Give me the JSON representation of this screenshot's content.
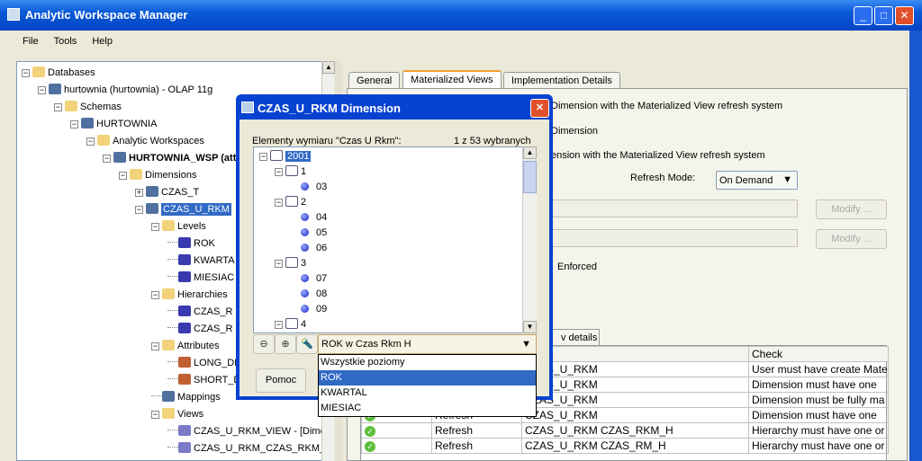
{
  "window": {
    "title": "Analytic Workspace Manager",
    "controls": [
      "_",
      "□",
      "✕"
    ]
  },
  "menu": [
    "File",
    "Tools",
    "Help"
  ],
  "tree": [
    {
      "label": "Databases",
      "level": 0,
      "exp": "-",
      "icon": "folder-db"
    },
    {
      "label": "hurtownia (hurtownia) - OLAP 11g",
      "level": 1,
      "exp": "-",
      "icon": "database"
    },
    {
      "label": "Schemas",
      "level": 2,
      "exp": "-",
      "icon": "folder-schema"
    },
    {
      "label": "HURTOWNIA",
      "level": 3,
      "exp": "-",
      "icon": "schema"
    },
    {
      "label": "Analytic Workspaces",
      "level": 4,
      "exp": "-",
      "icon": "folder-aw"
    },
    {
      "label": "HURTOWNIA_WSP (atta",
      "level": 5,
      "exp": "-",
      "icon": "aw",
      "bold": true
    },
    {
      "label": "Dimensions",
      "level": 6,
      "exp": "-",
      "icon": "folder-dimension"
    },
    {
      "label": "CZAS_T",
      "level": 7,
      "exp": "+",
      "icon": "dimension"
    },
    {
      "label": "CZAS_U_RKM",
      "level": 7,
      "exp": "-",
      "icon": "dimension",
      "selected": true
    },
    {
      "label": "Levels",
      "level": 8,
      "exp": "-",
      "icon": "folder-levels"
    },
    {
      "label": "ROK",
      "level": 9,
      "icon": "level"
    },
    {
      "label": "KWARTA",
      "level": 9,
      "icon": "level"
    },
    {
      "label": "MIESIAC",
      "level": 9,
      "icon": "level"
    },
    {
      "label": "Hierarchies",
      "level": 8,
      "exp": "-",
      "icon": "folder-hierarchy"
    },
    {
      "label": "CZAS_R",
      "level": 9,
      "icon": "hierarchy"
    },
    {
      "label": "CZAS_R",
      "level": 9,
      "icon": "hierarchy"
    },
    {
      "label": "Attributes",
      "level": 8,
      "exp": "-",
      "icon": "folder-attributes"
    },
    {
      "label": "LONG_DE",
      "level": 9,
      "icon": "attribute"
    },
    {
      "label": "SHORT_D",
      "level": 9,
      "icon": "attribute"
    },
    {
      "label": "Mappings",
      "level": 8,
      "icon": "mappings"
    },
    {
      "label": "Views",
      "level": 8,
      "exp": "-",
      "icon": "folder-views"
    },
    {
      "label": "CZAS_U_RKM_VIEW - [Dime",
      "level": 9,
      "icon": "view"
    },
    {
      "label": "CZAS_U_RKM_CZAS_RKM_",
      "level": 9,
      "icon": "view"
    }
  ],
  "tabs": [
    "General",
    "Materialized Views",
    "Implementation Details"
  ],
  "active_tab": "Materialized Views",
  "right": {
    "line1": "Dimension with the Materialized View refresh system",
    "line2": "Dimension",
    "line3": "ension with the Materialized View refresh system",
    "refresh_mode_label": "Refresh Mode:",
    "refresh_mode_value": "On Demand",
    "modify1": "Modify ...",
    "modify2": "Modify ...",
    "enforced": "Enforced",
    "details_tab": "v details",
    "table": {
      "headers": [
        "",
        "",
        "t",
        "Check"
      ],
      "rows": [
        [
          "",
          "",
          "CZAS_U_RKM",
          "User must have create Mate"
        ],
        [
          "",
          "",
          "CZAS_U_RKM",
          "Dimension must have one"
        ],
        [
          "",
          "",
          "CZAS_U_RKM",
          "Dimension must be fully ma"
        ],
        [
          "✓",
          "Refresh",
          "CZAS_U_RKM",
          "Dimension must have one"
        ],
        [
          "✓",
          "Refresh",
          "CZAS_U_RKM CZAS_RKM_H",
          "Hierarchy must have one or"
        ],
        [
          "✓",
          "Refresh",
          "CZAS_U_RKM CZAS_RM_H",
          "Hierarchy must have one or"
        ]
      ]
    }
  },
  "dialog": {
    "title": "CZAS_U_RKM Dimension",
    "label": "Elementy wymiaru \"Czas U Rkm\":",
    "count": "1 z 53 wybranych",
    "members": [
      {
        "label": "2001",
        "type": "node",
        "level": 0,
        "selected": true
      },
      {
        "label": "1",
        "type": "node",
        "level": 1
      },
      {
        "label": "03",
        "type": "leaf",
        "level": 2
      },
      {
        "label": "2",
        "type": "node",
        "level": 1
      },
      {
        "label": "04",
        "type": "leaf",
        "level": 2
      },
      {
        "label": "05",
        "type": "leaf",
        "level": 2
      },
      {
        "label": "06",
        "type": "leaf",
        "level": 2
      },
      {
        "label": "3",
        "type": "node",
        "level": 1
      },
      {
        "label": "07",
        "type": "leaf",
        "level": 2
      },
      {
        "label": "08",
        "type": "leaf",
        "level": 2
      },
      {
        "label": "09",
        "type": "leaf",
        "level": 2
      },
      {
        "label": "4",
        "type": "node",
        "level": 1
      }
    ],
    "combo_value": "ROK w Czas Rkm H",
    "options": [
      "Wszystkie poziomy",
      "ROK",
      "KWARTAL",
      "MIESIAC"
    ],
    "selected_option": "ROK",
    "help_button": "Pomoc"
  }
}
